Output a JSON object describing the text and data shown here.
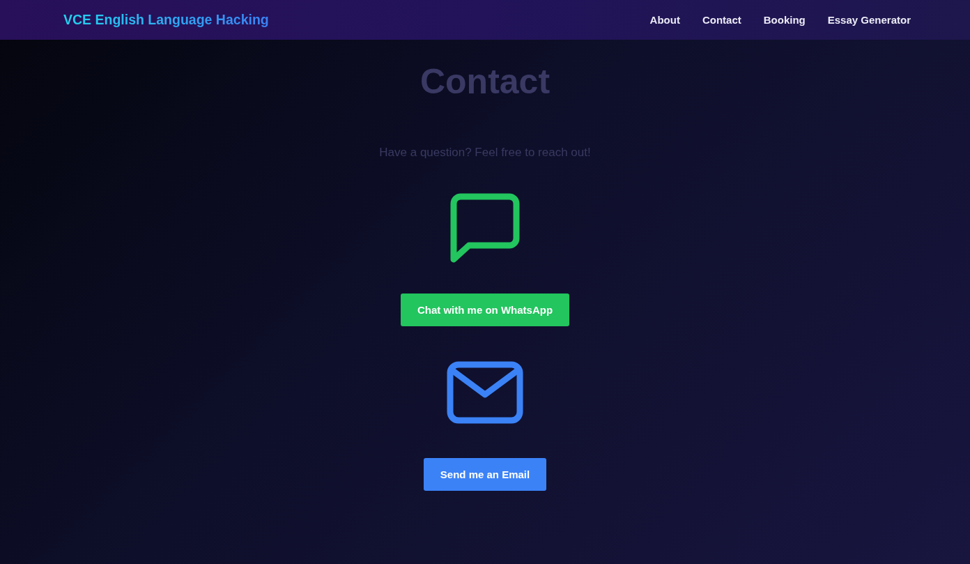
{
  "navbar": {
    "logo": "VCE English Language Hacking",
    "links": [
      "About",
      "Contact",
      "Booking",
      "Essay Generator"
    ]
  },
  "page": {
    "title": "Contact",
    "subtitle": "Have a question? Feel free to reach out!",
    "contacts": [
      {
        "kind": "chat",
        "button": "Chat with me on WhatsApp"
      },
      {
        "kind": "email",
        "button": "Send me an Email"
      }
    ]
  }
}
